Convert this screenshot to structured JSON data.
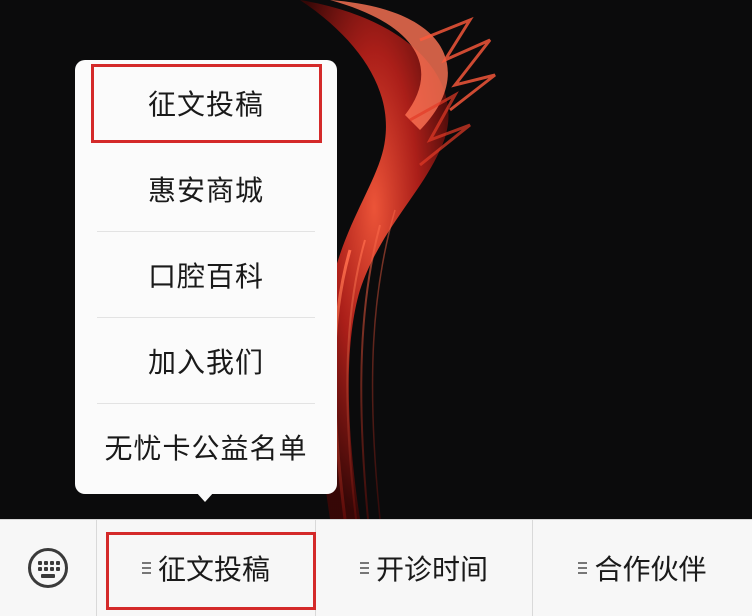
{
  "popup_menu": {
    "items": [
      {
        "label": "征文投稿"
      },
      {
        "label": "惠安商城"
      },
      {
        "label": "口腔百科"
      },
      {
        "label": "加入我们"
      },
      {
        "label": "无忧卡公益名单"
      }
    ],
    "highlighted_item": "征文投稿"
  },
  "bottom_menu": {
    "keyboard_icon": "keyboard-icon",
    "tabs": [
      {
        "label": "征文投稿",
        "icon": "menu-lines-icon",
        "active": true
      },
      {
        "label": "开诊时间",
        "icon": "menu-lines-icon"
      },
      {
        "label": "合作伙伴",
        "icon": "menu-lines-icon"
      }
    ]
  },
  "colors": {
    "background": "#0b0b0c",
    "popup": "#fbfbfb",
    "highlight": "#d42a2a",
    "bar": "#f7f7f7"
  }
}
